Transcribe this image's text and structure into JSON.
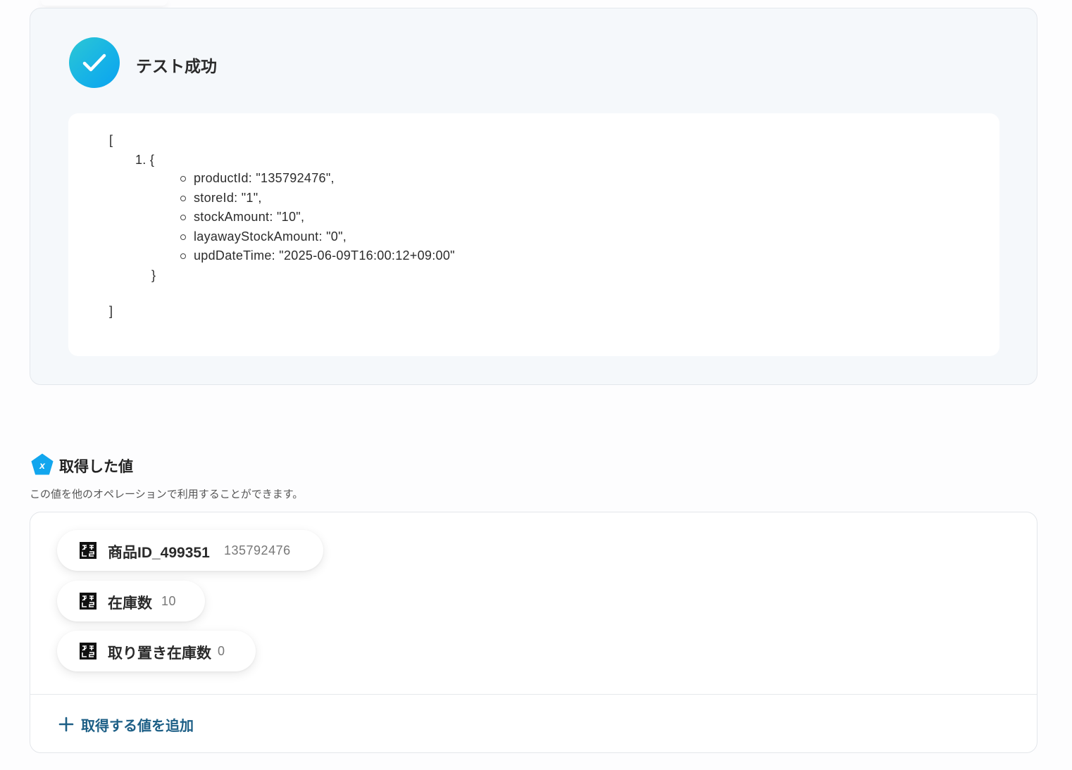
{
  "test_result": {
    "title": "テスト成功",
    "icon": "check-icon",
    "code": {
      "open_bracket": "[",
      "item_open": "1. {",
      "fields": [
        "productId: \"135792476\",",
        "storeId: \"1\",",
        "stockAmount: \"10\",",
        "layawayStockAmount: \"0\",",
        "updDateTime: \"2025-06-09T16:00:12+09:00\""
      ],
      "item_close": "}",
      "close_bracket": "]"
    }
  },
  "obtained_values": {
    "title": "取得した値",
    "icon": "variable-pentagon-icon",
    "description": "この値を他のオペレーションで利用することができます。",
    "items": [
      {
        "label": "商品ID_499351",
        "value": "135792476",
        "icon": "text-value-icon"
      },
      {
        "label": "在庫数",
        "value": "10",
        "icon": "text-value-icon"
      },
      {
        "label": "取り置き在庫数",
        "value": "0",
        "icon": "text-value-icon"
      }
    ],
    "add_label": "取得する値を追加"
  },
  "colors": {
    "accent": "#17b3e6",
    "link": "#1d5f86",
    "panel_bg": "#f5f8fb"
  }
}
